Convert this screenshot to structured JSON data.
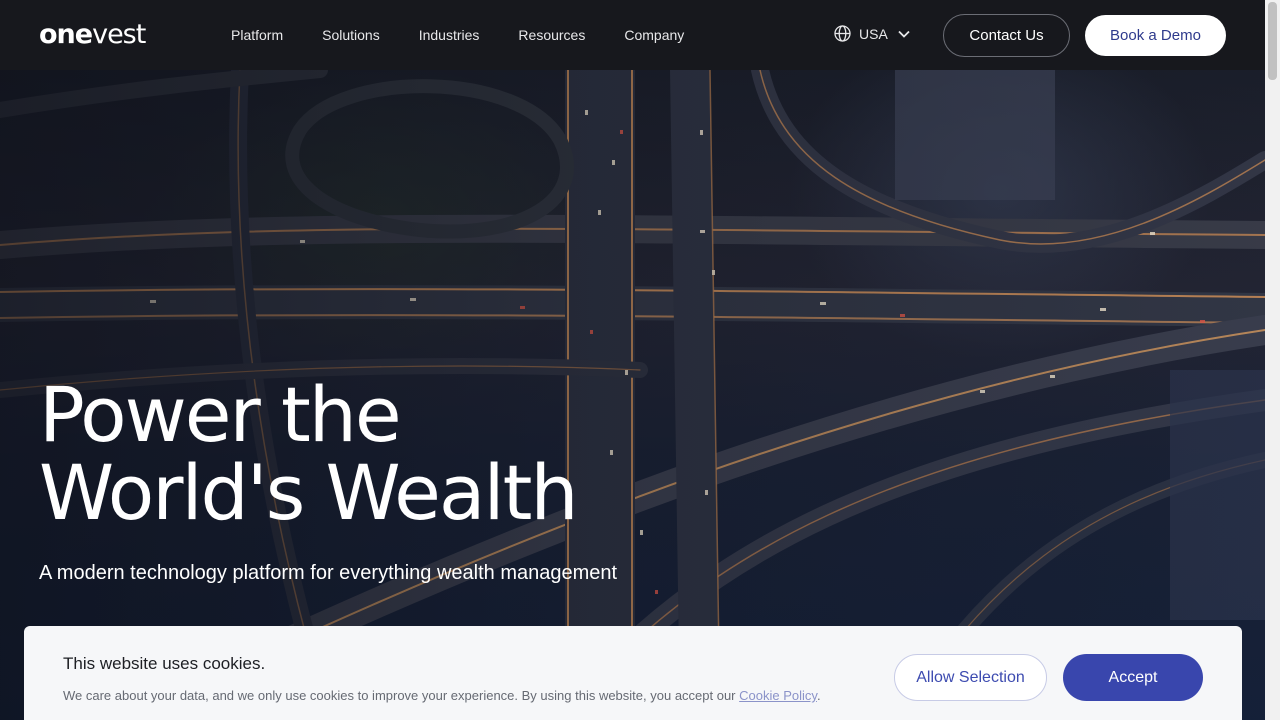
{
  "header": {
    "logo_bold": "one",
    "logo_light": "vest",
    "nav": [
      "Platform",
      "Solutions",
      "Industries",
      "Resources",
      "Company"
    ],
    "region": {
      "label": "USA",
      "icon": "globe-icon",
      "chevron": "chevron-down-icon"
    },
    "contact_label": "Contact Us",
    "demo_label": "Book a Demo"
  },
  "hero": {
    "headline_line1": "Power the",
    "headline_line2": "World's Wealth",
    "subheadline": "A modern technology platform for everything wealth management",
    "background_image": "aerial night view of highway interchange"
  },
  "cookie_banner": {
    "title": "This website uses cookies.",
    "text": "We care about your data, and we only use cookies to improve your experience. By using this website, you accept our ",
    "policy_link": "Cookie Policy",
    "text_end": ".",
    "allow_label": "Allow Selection",
    "accept_label": "Accept"
  },
  "colors": {
    "header_bg": "#17181d",
    "accent": "#3946ad",
    "demo_text": "#2e3a8c"
  }
}
